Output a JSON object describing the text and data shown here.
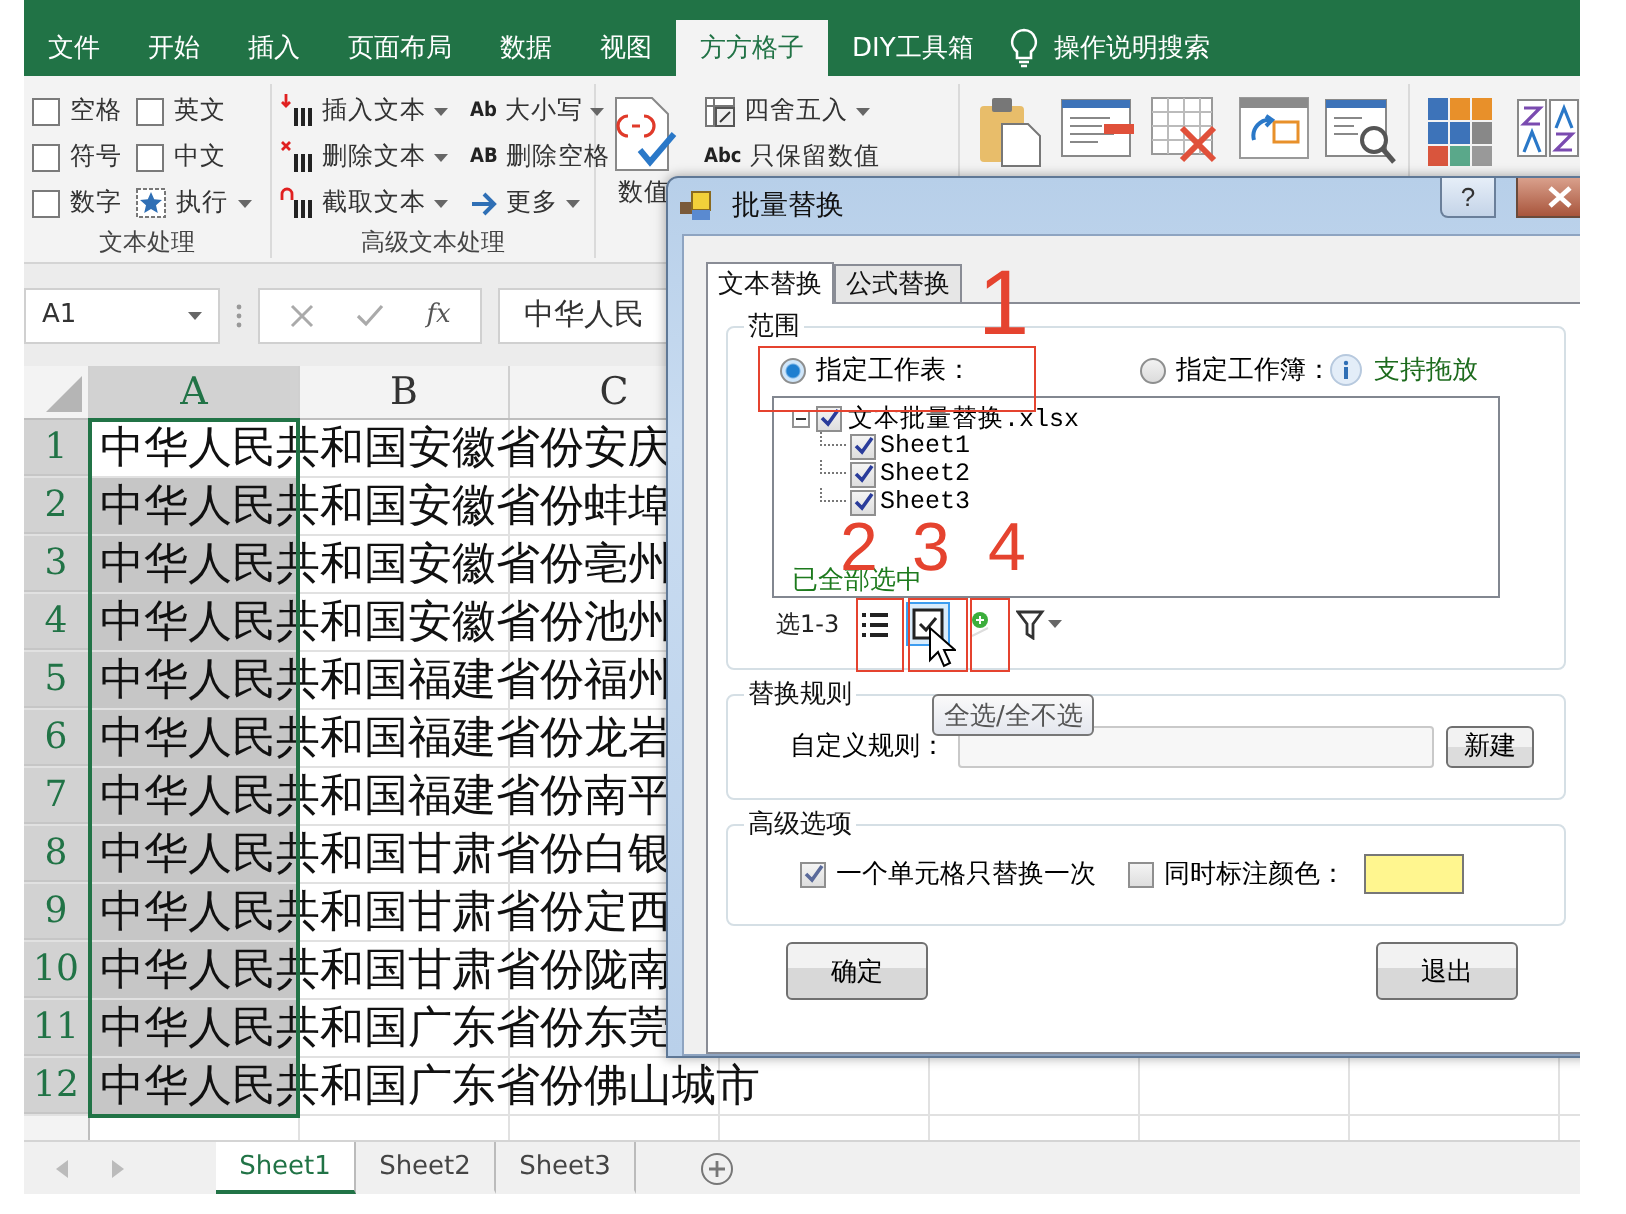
{
  "ribbon": {
    "tabs": [
      {
        "label": "文件",
        "selected": false
      },
      {
        "label": "开始",
        "selected": false
      },
      {
        "label": "插入",
        "selected": false
      },
      {
        "label": "页面布局",
        "selected": false
      },
      {
        "label": "数据",
        "selected": false
      },
      {
        "label": "视图",
        "selected": false
      },
      {
        "label": "方方格子",
        "selected": true
      },
      {
        "label": "DIY工具箱",
        "selected": false
      }
    ],
    "search": "操作说明搜索",
    "text_group": {
      "label": "文本处理",
      "options": [
        {
          "label": "空格",
          "checked": false
        },
        {
          "label": "英文",
          "checked": false
        },
        {
          "label": "符号",
          "checked": false
        },
        {
          "label": "中文",
          "checked": false
        },
        {
          "label": "数字",
          "checked": false
        }
      ],
      "run": "执行"
    },
    "advanced_group": {
      "label": "高级文本处理",
      "commands": [
        {
          "label": "插入文本",
          "kind": "insert"
        },
        {
          "label": "删除文本",
          "kind": "delete"
        },
        {
          "label": "截取文本",
          "kind": "cut"
        },
        {
          "label": "大小写",
          "kind": "case",
          "icon_text": "Ab"
        },
        {
          "label": "删除空格",
          "kind": "trim",
          "icon_text": "AB"
        },
        {
          "label": "更多",
          "kind": "more"
        }
      ]
    },
    "number_group": {
      "big_button": "数值",
      "commands": [
        {
          "label": "四舍五入",
          "kind": "round",
          "dropdown": true
        },
        {
          "label": "只保留数值",
          "kind": "values",
          "dropdown": false,
          "icon_text": "Abc"
        }
      ]
    },
    "tools": [
      {
        "kind": "paste"
      },
      {
        "kind": "form"
      },
      {
        "kind": "delete-grid"
      },
      {
        "kind": "merge"
      },
      {
        "kind": "find"
      }
    ],
    "tools_2": [
      {
        "kind": "blocks"
      },
      {
        "kind": "sort"
      }
    ]
  },
  "formula_bar": {
    "name_box": "A1",
    "insert_function": "fx",
    "formula": "中华人民"
  },
  "sheet": {
    "columns": [
      {
        "label": "A",
        "selected": true
      },
      {
        "label": "B",
        "selected": false
      },
      {
        "label": "C",
        "selected": false
      }
    ],
    "rows": [
      {
        "header": "1",
        "text": "中华人民共和国安徽省份安庆",
        "active": true
      },
      {
        "header": "2",
        "text": "中华人民共和国安徽省份蚌埠",
        "active": false
      },
      {
        "header": "3",
        "text": "中华人民共和国安徽省份亳州",
        "active": false
      },
      {
        "header": "4",
        "text": "中华人民共和国安徽省份池州",
        "active": false
      },
      {
        "header": "5",
        "text": "中华人民共和国福建省份福州",
        "active": false
      },
      {
        "header": "6",
        "text": "中华人民共和国福建省份龙岩",
        "active": false
      },
      {
        "header": "7",
        "text": "中华人民共和国福建省份南平",
        "active": false
      },
      {
        "header": "8",
        "text": "中华人民共和国甘肃省份白银",
        "active": false
      },
      {
        "header": "9",
        "text": "中华人民共和国甘肃省份定西",
        "active": false
      },
      {
        "header": "10",
        "text": "中华人民共和国甘肃省份陇南",
        "active": false
      },
      {
        "header": "11",
        "text": "中华人民共和国广东省份东莞",
        "active": false
      },
      {
        "header": "12",
        "text": "中华人民共和国广东省份佛山城市",
        "active": false
      }
    ]
  },
  "sheet_tabs": [
    {
      "label": "Sheet1",
      "selected": true
    },
    {
      "label": "Sheet2",
      "selected": false
    },
    {
      "label": "Sheet3",
      "selected": false
    }
  ],
  "dialog": {
    "title": "批量替换",
    "help_button": "?",
    "tabs": [
      {
        "label": "文本替换",
        "selected": true
      },
      {
        "label": "公式替换",
        "selected": false
      }
    ],
    "scope": {
      "legend": "范围",
      "options": [
        {
          "label": "指定工作表：",
          "selected": true
        },
        {
          "label": "指定工作簿：",
          "selected": false
        }
      ],
      "hint": "支持拖放",
      "tree": {
        "label": "文本批量替换.xlsx",
        "checked": true,
        "expanded": true,
        "children": [
          {
            "label": "Sheet1",
            "checked": true
          },
          {
            "label": "Sheet2",
            "checked": true
          },
          {
            "label": "Sheet3",
            "checked": true
          }
        ]
      },
      "status": "已全部选中",
      "range_label": "选1-3"
    },
    "rules": {
      "legend": "替换规则",
      "label": "自定义规则：",
      "button": "新建"
    },
    "advanced": {
      "legend": "高级选项",
      "options": [
        {
          "label": "一个单元格只替换一次",
          "checked": true
        },
        {
          "label": "同时标注颜色：",
          "checked": false
        }
      ],
      "color": "#fff68f"
    },
    "buttons": [
      "确定",
      "退出"
    ],
    "tooltip": "全选/全不选",
    "annotations": [
      "1",
      "2",
      "3",
      "4"
    ]
  }
}
